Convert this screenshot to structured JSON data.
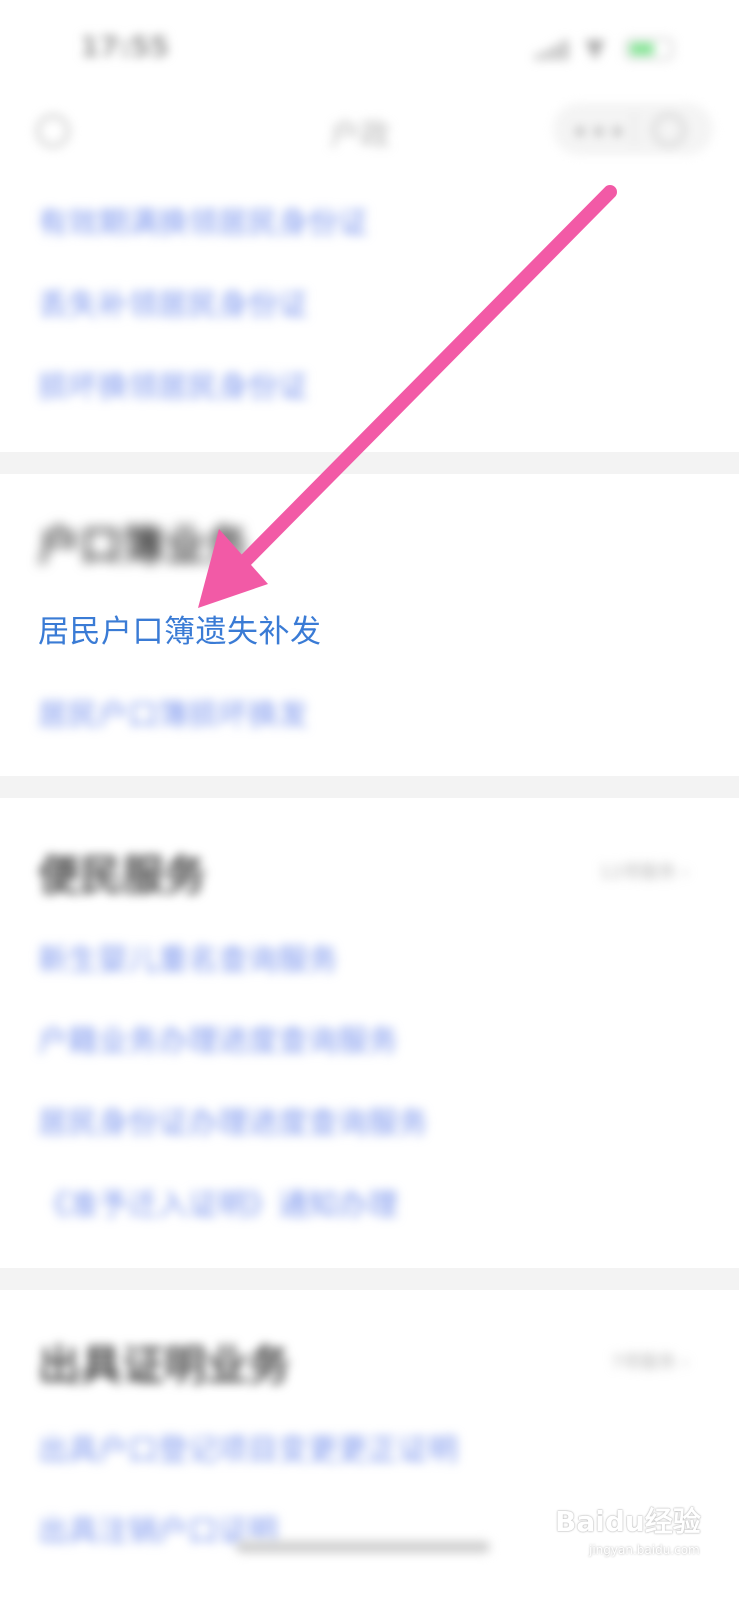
{
  "status_bar": {
    "time": "17:55"
  },
  "header": {
    "title": "户政",
    "more_glyph": "•••"
  },
  "id_card_links": [
    "有效期满换领居民身份证",
    "丢失补领居民身份证",
    "损坏换领居民身份证"
  ],
  "hukou_section": {
    "heading": "户口簿业务",
    "links": [
      "居民户口簿遗失补发",
      "居民户口簿损坏换发"
    ]
  },
  "convenience_section": {
    "heading": "便民服务",
    "more": "12项服务 ›",
    "links": [
      "新生婴儿重名查询服务",
      "户籍业务办理进度查询服务",
      "居民身份证办理进度查询服务",
      "《准予迁入证明》通知办理"
    ]
  },
  "certificate_section": {
    "heading": "出具证明业务",
    "more": "7项服务 ›",
    "links": [
      "出具户口登记项目变更更正证明",
      "出具注销户口证明"
    ]
  },
  "watermark": {
    "logo": "Baidu经验",
    "url": "jingyan.baidu.com"
  },
  "colors": {
    "link_blue": "#4a72e0",
    "highlight_blue": "#3a7bd5",
    "arrow_pink": "#f25aa6"
  }
}
